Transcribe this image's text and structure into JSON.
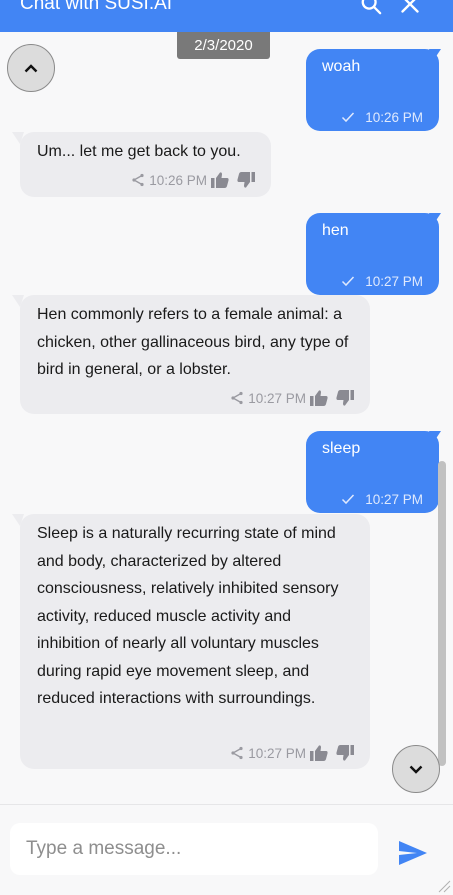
{
  "header": {
    "title": "Chat with SUSI.AI",
    "search_icon": "search-icon",
    "close_icon": "close-icon"
  },
  "date_chip": "2/3/2020",
  "messages": [
    {
      "sender": "user",
      "text": "woah",
      "time": "10:26 PM"
    },
    {
      "sender": "bot",
      "text": "Um... let me get back to you.",
      "time": "10:26 PM"
    },
    {
      "sender": "user",
      "text": "hen",
      "time": "10:27 PM"
    },
    {
      "sender": "bot",
      "text": "Hen commonly refers to a female animal: a chicken, other gallinaceous bird, any type of bird in general, or a lobster.",
      "time": "10:27 PM"
    },
    {
      "sender": "user",
      "text": "sleep",
      "time": "10:27 PM"
    },
    {
      "sender": "bot",
      "text": "Sleep is a naturally recurring state of mind and body, characterized by altered consciousness, relatively inhibited sensory activity, reduced muscle activity and inhibition of nearly all voluntary muscles during rapid eye movement sleep, and reduced interactions with surroundings.",
      "time": "10:27 PM"
    }
  ],
  "composer": {
    "placeholder": "Type a message..."
  },
  "colors": {
    "accent": "#4285f4",
    "bot_bubble": "#ececef",
    "date_chip": "#797979"
  }
}
